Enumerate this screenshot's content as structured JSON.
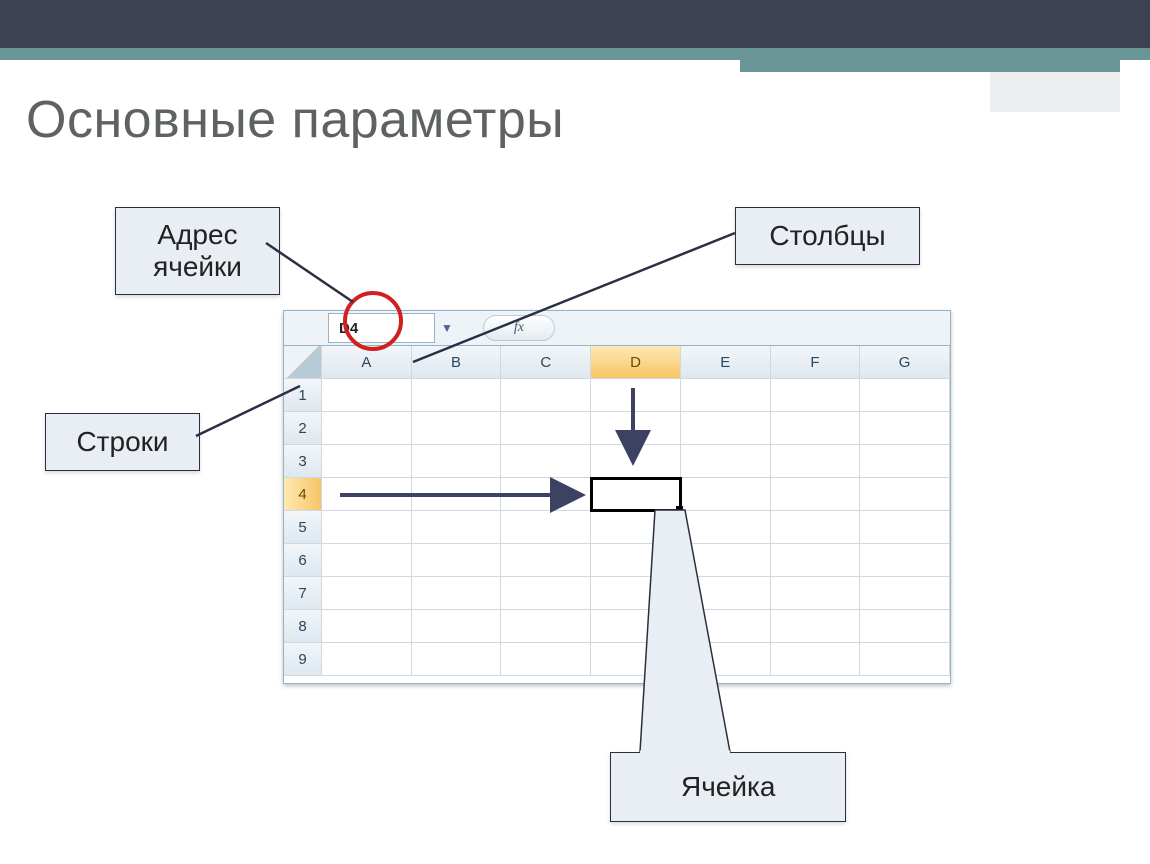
{
  "title": "Основные параметры",
  "labels": {
    "address": "Адрес ячейки",
    "rows": "Строки",
    "cols": "Столбцы",
    "cell": "Ячейка"
  },
  "spreadsheet": {
    "name_box": "D4",
    "fx": "fx",
    "columns": [
      "A",
      "B",
      "C",
      "D",
      "E",
      "F",
      "G"
    ],
    "rows": [
      "1",
      "2",
      "3",
      "4",
      "5",
      "6",
      "7",
      "8",
      "9"
    ],
    "active_col_index": 3,
    "active_row_index": 3
  }
}
